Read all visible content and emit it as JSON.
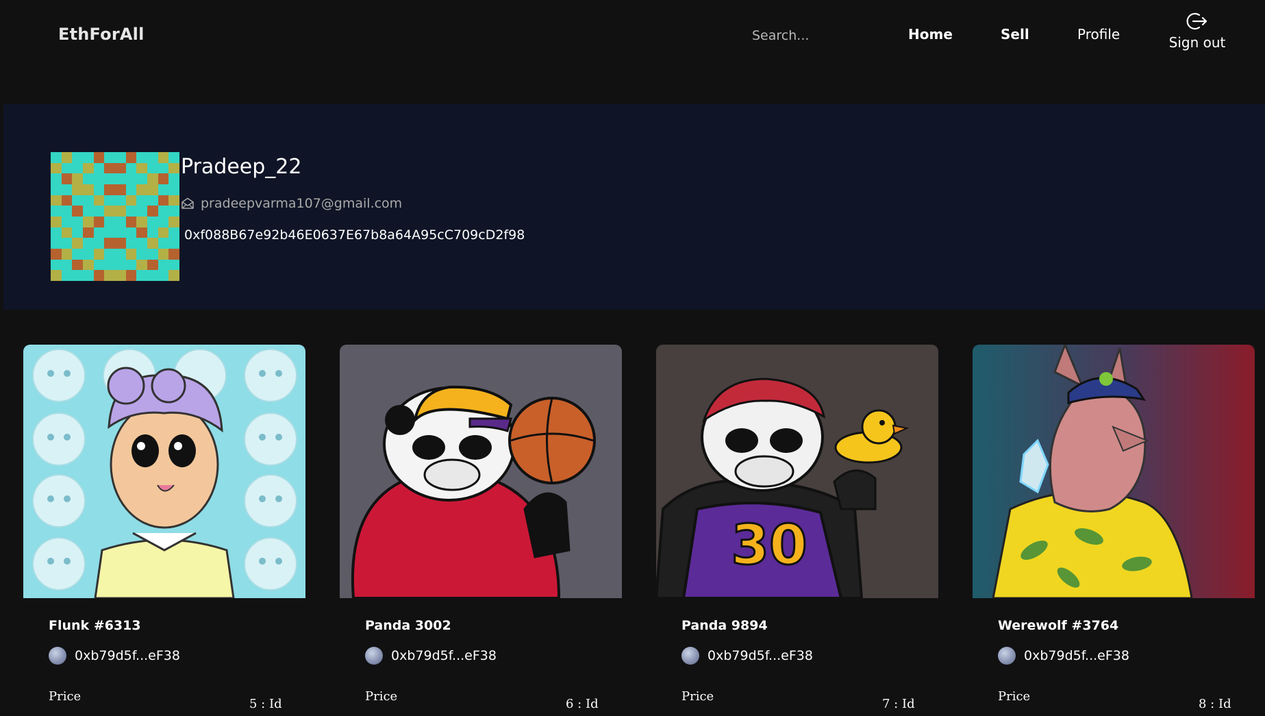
{
  "app": {
    "brand": "EthForAll"
  },
  "nav": {
    "search_placeholder": "Search...",
    "home": "Home",
    "sell": "Sell",
    "profile": "Profile",
    "signout": "Sign out"
  },
  "profile": {
    "username": "Pradeep_22",
    "email": "pradeepvarma107@gmail.com",
    "wallet": "0xf088B67e92b46E0637E67b8a64A95cC709cD2f98"
  },
  "colors": {
    "background": "#111112",
    "profile_band": "#0f1526",
    "avatar_teal": "#34d6c4",
    "avatar_olive": "#b3b046",
    "avatar_brown": "#b6622f"
  },
  "nfts": [
    {
      "name": "Flunk #6313",
      "owner": "0xb79d5f...eF38",
      "price_label": "Price",
      "id_label": "5 : Id",
      "image": "flunk-girl-art"
    },
    {
      "name": "Panda 3002",
      "owner": "0xb79d5f...eF38",
      "price_label": "Price",
      "id_label": "6 : Id",
      "image": "panda-basketball-art"
    },
    {
      "name": "Panda 9894",
      "owner": "0xb79d5f...eF38",
      "price_label": "Price",
      "id_label": "7 : Id",
      "image": "panda-duck-art"
    },
    {
      "name": "Werewolf #3764",
      "owner": "0xb79d5f...eF38",
      "price_label": "Price",
      "id_label": "8 : Id",
      "image": "werewolf-art"
    }
  ]
}
